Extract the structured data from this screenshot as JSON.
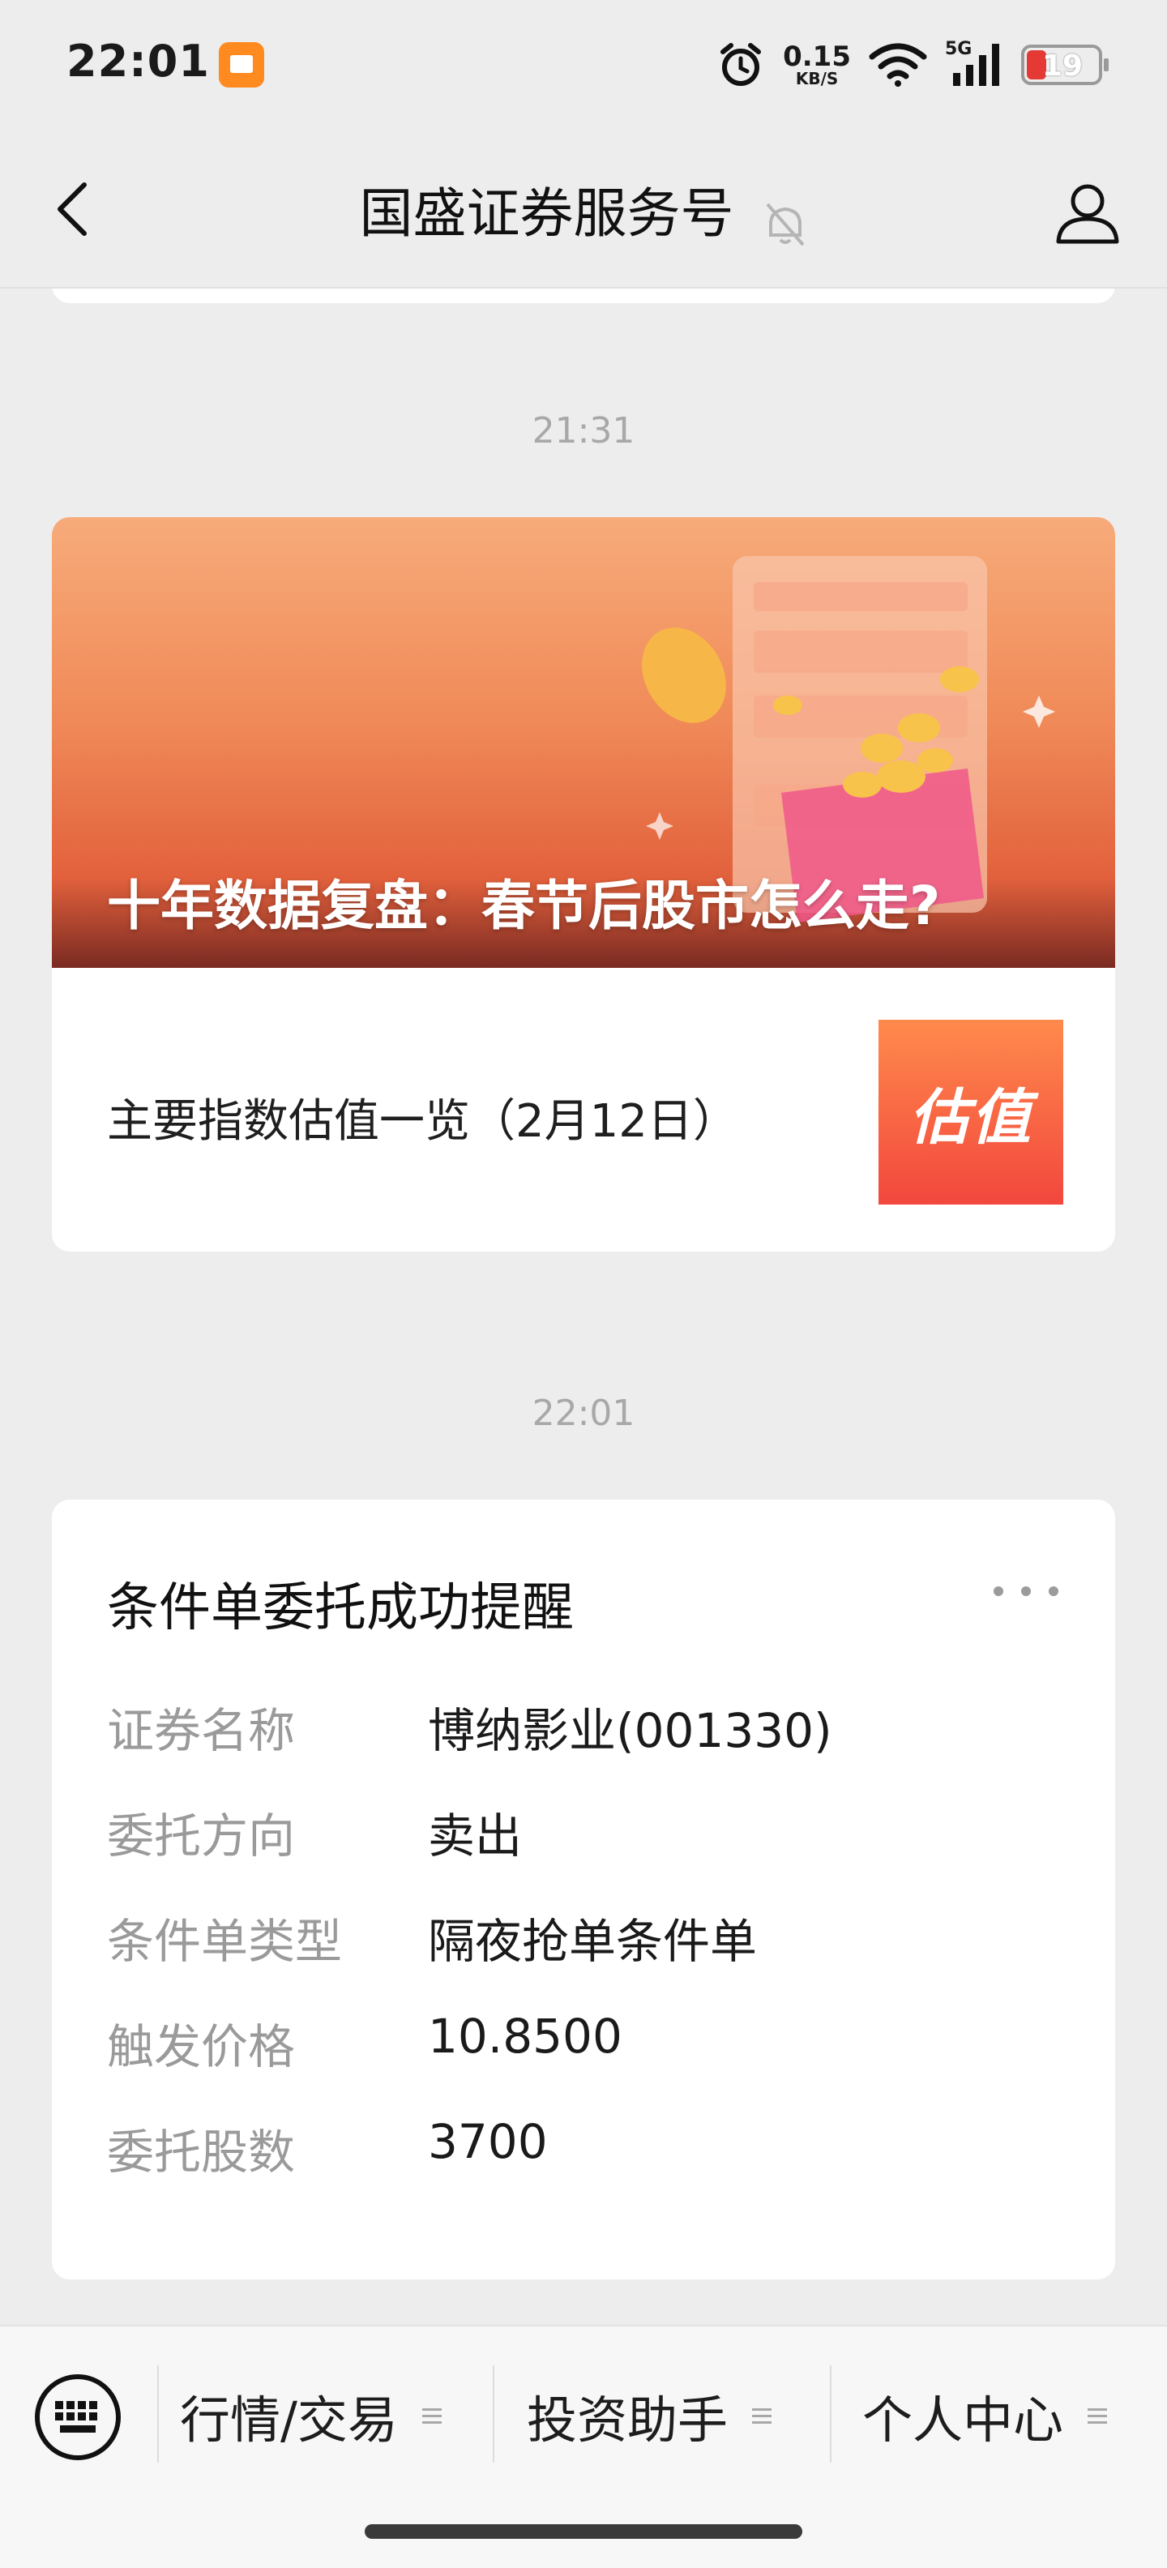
{
  "status_bar": {
    "time": "22:01",
    "net_speed_value": "0.15",
    "net_speed_unit": "KB/S",
    "cell_label": "5G",
    "battery_level": "19"
  },
  "header": {
    "title": "国盛证券服务号"
  },
  "messages": {
    "time_1": "21:31",
    "article": {
      "banner_title": "十年数据复盘：春节后股市怎么走?",
      "sub_title": "主要指数估值一览（2月12日）",
      "thumb_text": "估值"
    },
    "time_2": "22:01",
    "notification": {
      "title": "条件单委托成功提醒",
      "rows": [
        {
          "label": "证券名称",
          "value": "博纳影业(001330)"
        },
        {
          "label": "委托方向",
          "value": "卖出"
        },
        {
          "label": "条件单类型",
          "value": "隔夜抢单条件单"
        },
        {
          "label": "触发价格",
          "value": "10.8500"
        },
        {
          "label": "委托股数",
          "value": "3700"
        }
      ]
    }
  },
  "bottom_menu": {
    "items": [
      {
        "label": "行情/交易"
      },
      {
        "label": "投资助手"
      },
      {
        "label": "个人中心"
      }
    ]
  },
  "colors": {
    "accent_orange": "#f08a58",
    "thumb_red": "#f2473d",
    "battery_red": "#e53935"
  }
}
